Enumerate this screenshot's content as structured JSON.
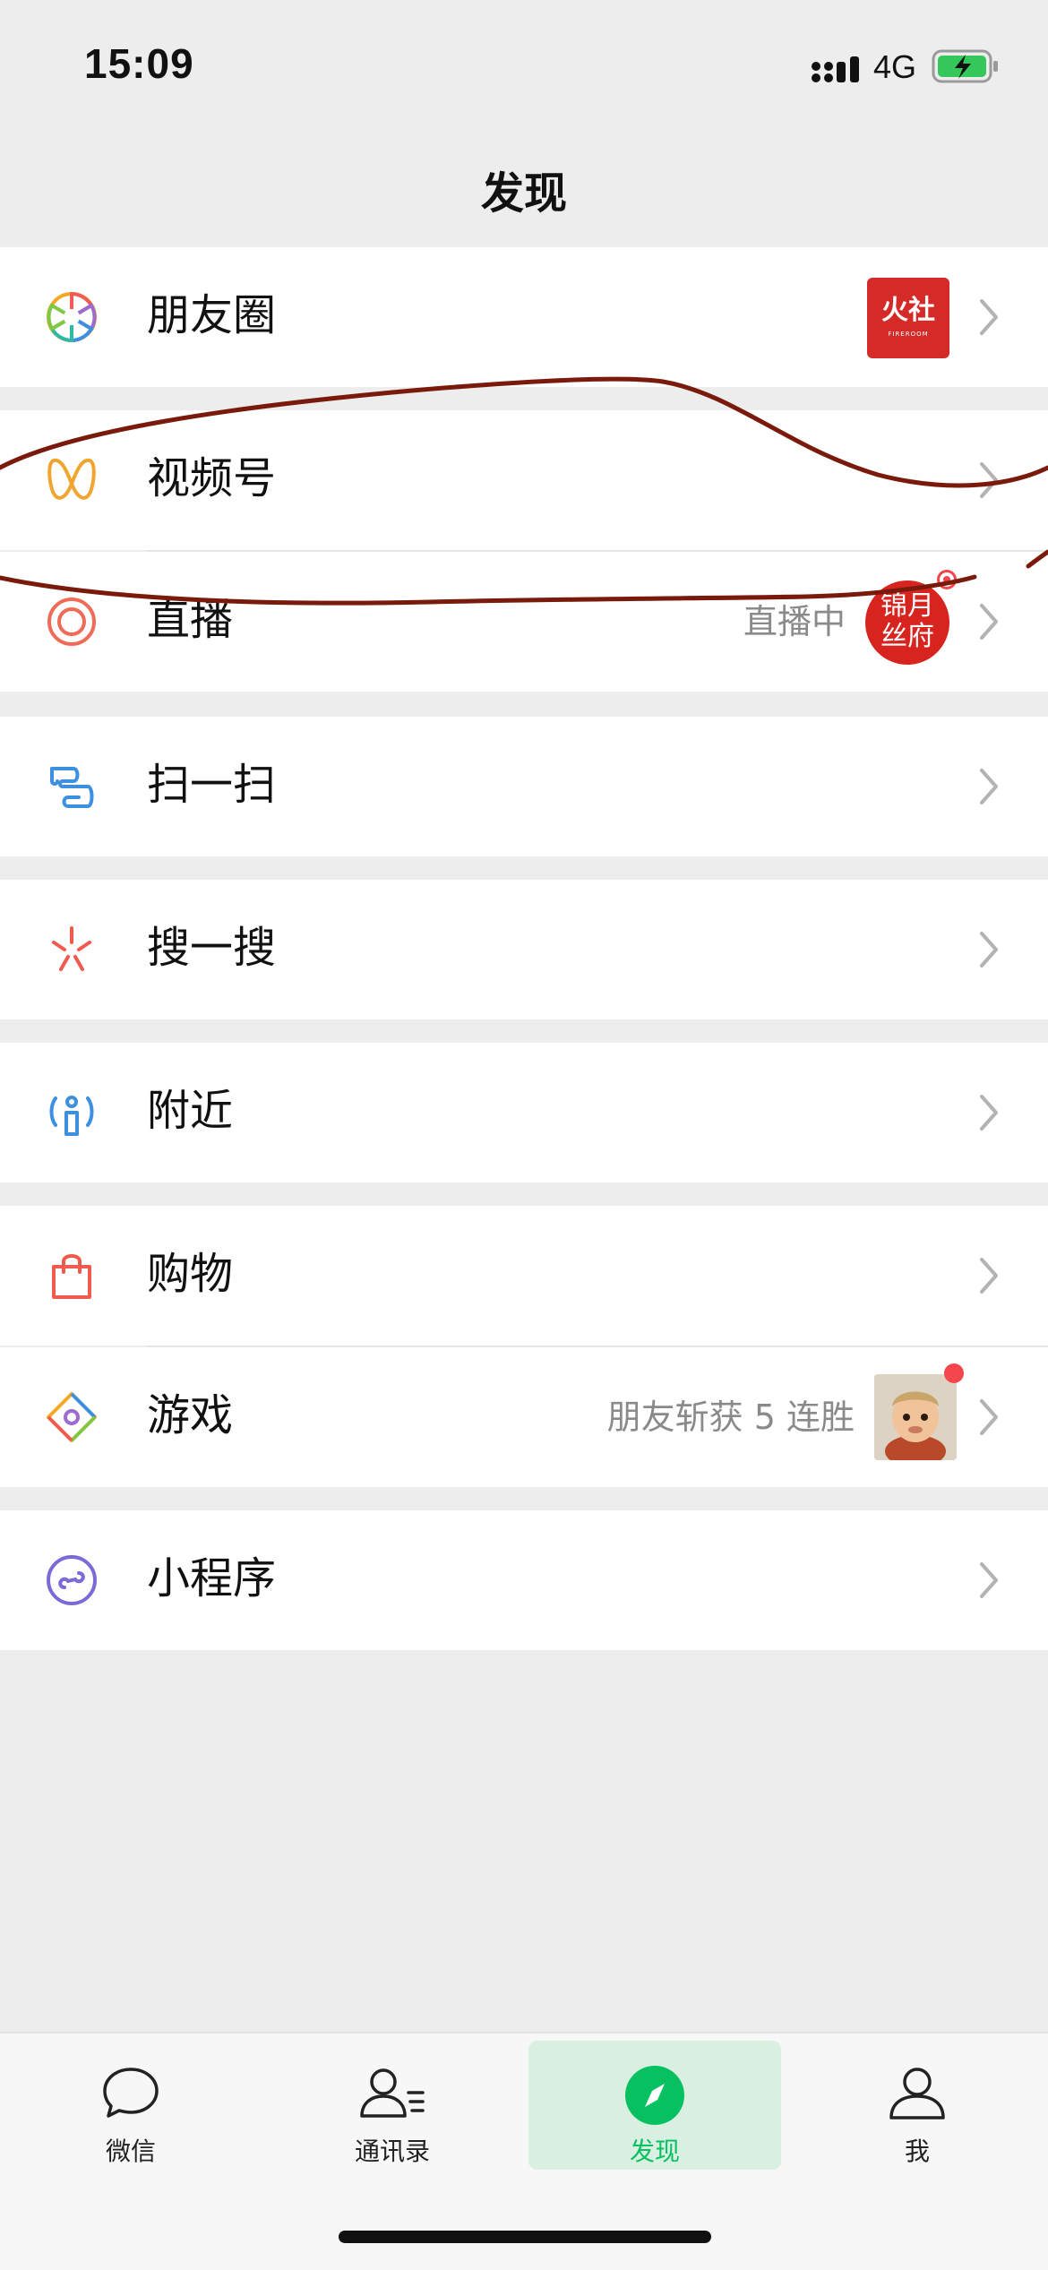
{
  "status_bar": {
    "time": "15:09",
    "network": "4G"
  },
  "title": "发现",
  "rows": [
    {
      "id": "moments",
      "label": "朋友圈",
      "icon": "moments-aperture-icon",
      "thumb_text": "火社",
      "thumb_sub": "FIREROOM"
    },
    {
      "id": "channels",
      "label": "视频号",
      "icon": "channels-butterfly-icon"
    },
    {
      "id": "live",
      "label": "直播",
      "icon": "live-ring-icon",
      "sub": "直播中",
      "thumb_text_1": "锦月",
      "thumb_text_2": "丝府"
    },
    {
      "id": "scan",
      "label": "扫一扫",
      "icon": "scan-icon"
    },
    {
      "id": "search",
      "label": "搜一搜",
      "icon": "search-sparkle-icon"
    },
    {
      "id": "nearby",
      "label": "附近",
      "icon": "nearby-person-icon"
    },
    {
      "id": "shopping",
      "label": "购物",
      "icon": "shopping-bag-icon"
    },
    {
      "id": "games",
      "label": "游戏",
      "icon": "games-diamond-icon",
      "sub": "朋友斩获 5 连胜"
    },
    {
      "id": "miniprogram",
      "label": "小程序",
      "icon": "mini-program-icon"
    }
  ],
  "tabs": [
    {
      "label": "微信",
      "icon": "chat-bubble-icon"
    },
    {
      "label": "通讯录",
      "icon": "contacts-icon"
    },
    {
      "label": "发现",
      "icon": "compass-icon",
      "active": true
    },
    {
      "label": "我",
      "icon": "profile-icon"
    }
  ],
  "colors": {
    "accent": "#07c160",
    "annotation": "#7a1a0c",
    "badge": "#f5454d"
  }
}
